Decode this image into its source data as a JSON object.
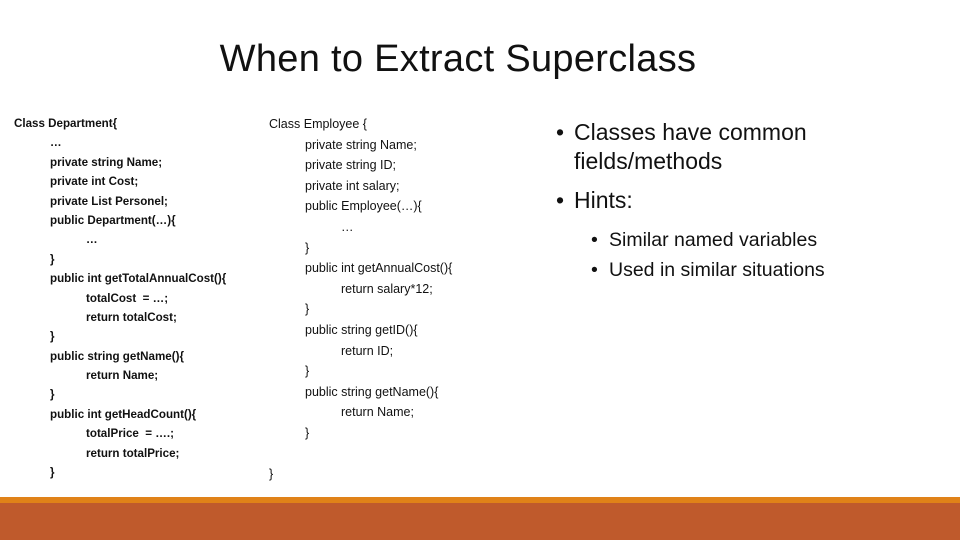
{
  "slide": {
    "title": "When to Extract Superclass",
    "colors": {
      "footer_stripe": "#e08218",
      "footer_bar": "#bf5a2c"
    }
  },
  "department_code": [
    {
      "indent": 0,
      "text": "Class Department{"
    },
    {
      "indent": 1,
      "text": "…"
    },
    {
      "indent": 1,
      "text": "private string Name;"
    },
    {
      "indent": 1,
      "text": "private int Cost;"
    },
    {
      "indent": 1,
      "text": "private List Personel;"
    },
    {
      "indent": 1,
      "text": "public Department(…){"
    },
    {
      "indent": 2,
      "text": "…"
    },
    {
      "indent": 1,
      "text": "}"
    },
    {
      "indent": 1,
      "text": "public int getTotalAnnualCost(){"
    },
    {
      "indent": 2,
      "text": "totalCost  = …;"
    },
    {
      "indent": 2,
      "text": "return totalCost;"
    },
    {
      "indent": 1,
      "text": "}"
    },
    {
      "indent": 1,
      "text": "public string getName(){"
    },
    {
      "indent": 2,
      "text": "return Name;"
    },
    {
      "indent": 1,
      "text": "}"
    },
    {
      "indent": 1,
      "text": "public int getHeadCount(){"
    },
    {
      "indent": 2,
      "text": "totalPrice  = ….;"
    },
    {
      "indent": 2,
      "text": "return totalPrice;"
    },
    {
      "indent": 1,
      "text": "}"
    },
    {
      "indent": 0,
      "text": ""
    },
    {
      "indent": 0,
      "text": "}"
    }
  ],
  "employee_code": [
    {
      "indent": 0,
      "text": "Class Employee {"
    },
    {
      "indent": 1,
      "text": "private string Name;"
    },
    {
      "indent": 1,
      "text": "private string ID;"
    },
    {
      "indent": 1,
      "text": "private int salary;"
    },
    {
      "indent": 1,
      "text": "public Employee(…){"
    },
    {
      "indent": 2,
      "text": "…"
    },
    {
      "indent": 1,
      "text": "}"
    },
    {
      "indent": 1,
      "text": "public int getAnnualCost(){"
    },
    {
      "indent": 2,
      "text": "return salary*12;"
    },
    {
      "indent": 1,
      "text": "}"
    },
    {
      "indent": 1,
      "text": "public string getID(){"
    },
    {
      "indent": 2,
      "text": "return ID;"
    },
    {
      "indent": 1,
      "text": "}"
    },
    {
      "indent": 1,
      "text": "public string getName(){"
    },
    {
      "indent": 2,
      "text": "return Name;"
    },
    {
      "indent": 1,
      "text": "}"
    },
    {
      "indent": 0,
      "text": ""
    },
    {
      "indent": 0,
      "text": "}"
    }
  ],
  "bullets": {
    "bullet_glyph": "•",
    "level1": [
      {
        "text": "Classes have common fields/methods"
      },
      {
        "text": "Hints:"
      }
    ],
    "hints": [
      {
        "text": "Similar named variables"
      },
      {
        "text": "Used in similar situations"
      }
    ]
  }
}
